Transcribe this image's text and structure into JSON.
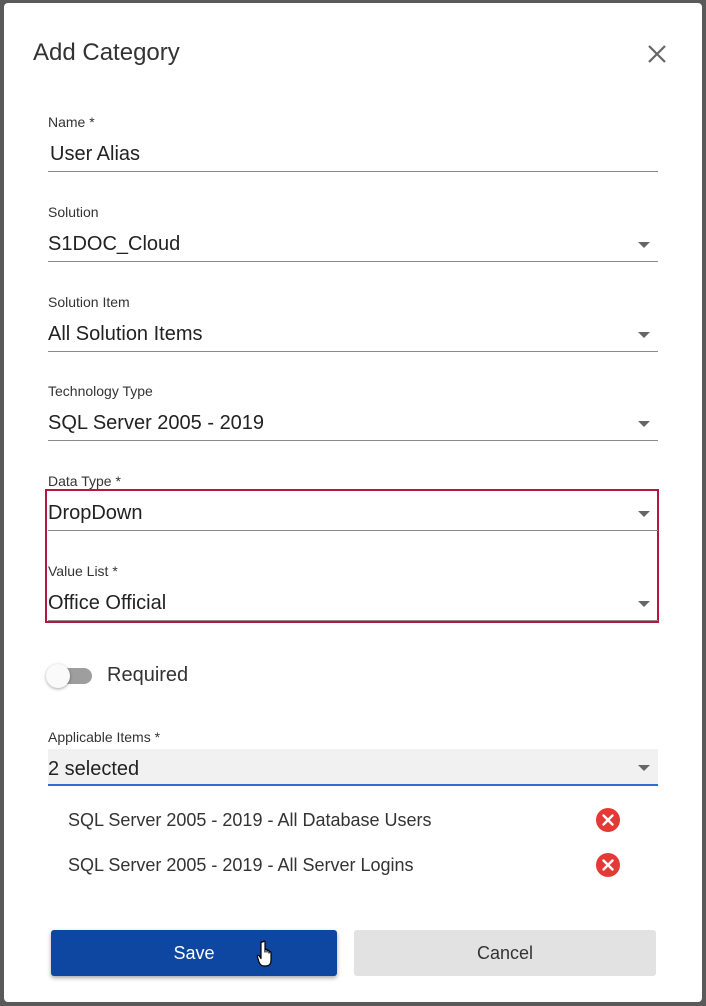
{
  "dialog": {
    "title": "Add Category",
    "close_icon": "close-icon"
  },
  "fields": {
    "name": {
      "label": "Name *",
      "value": "User Alias"
    },
    "solution": {
      "label": "Solution",
      "value": "S1DOC_Cloud"
    },
    "solution_item": {
      "label": "Solution Item",
      "value": "All Solution Items"
    },
    "technology_type": {
      "label": "Technology Type",
      "value": "SQL Server 2005 - 2019"
    },
    "data_type": {
      "label": "Data Type *",
      "value": "DropDown"
    },
    "value_list": {
      "label": "Value List *",
      "value": "Office Official"
    }
  },
  "required_toggle": {
    "label": "Required",
    "on": false
  },
  "applicable_items": {
    "label": "Applicable Items *",
    "value": "2 selected",
    "items": [
      {
        "text": "SQL Server 2005 - 2019 - All Database Users"
      },
      {
        "text": "SQL Server 2005 - 2019 - All Server Logins"
      }
    ]
  },
  "buttons": {
    "save": "Save",
    "cancel": "Cancel"
  },
  "colors": {
    "primary": "#0d47a1",
    "highlight_border": "#b3193f",
    "remove": "#e53935",
    "focus_underline": "#2f6fd0"
  }
}
